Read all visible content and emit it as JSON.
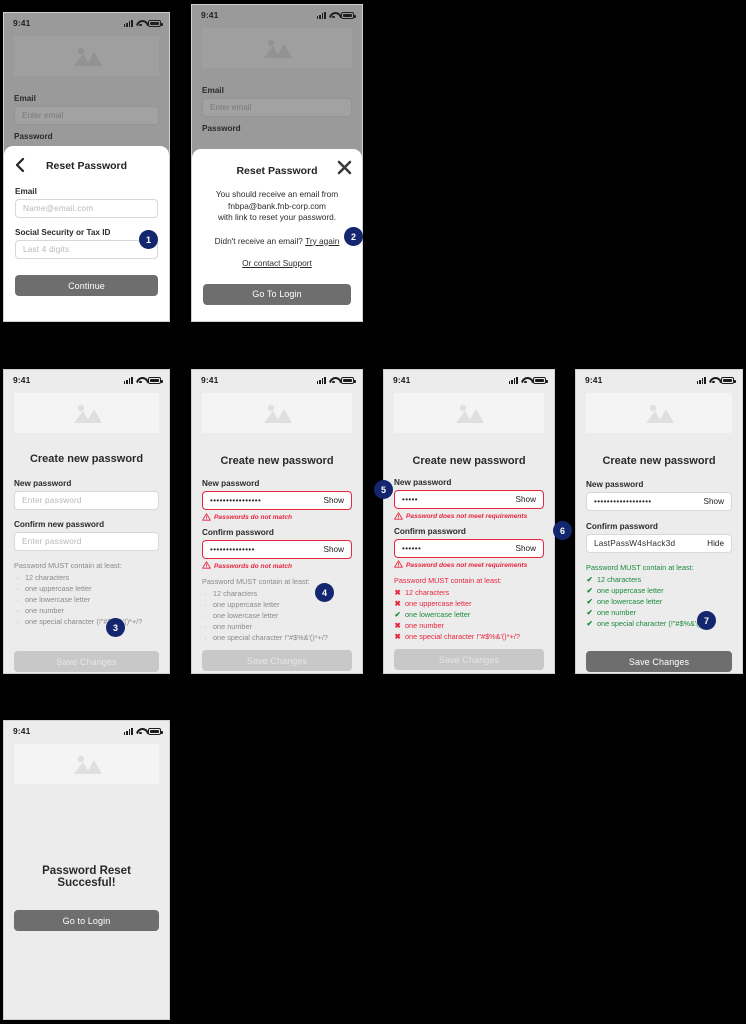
{
  "meta": {
    "status_time": "9:41",
    "accent_badge_color": "#13266e",
    "error_color": "#e8253f",
    "success_color": "#1a8a3c",
    "muted_color": "#8a8a8a",
    "button_color": "#6e6e6e"
  },
  "screens": {
    "reset_password_form": {
      "background": {
        "email_label": "Email",
        "email_placeholder": "Enter email",
        "password_label": "Password"
      },
      "modal": {
        "title": "Reset Password",
        "back_icon": "chevron-left-icon",
        "email_label": "Email",
        "email_placeholder": "Name@email.com",
        "ssn_label": "Social Security or Tax ID",
        "ssn_placeholder": "Last 4 digits",
        "submit_label": "Continue"
      },
      "badge": "1"
    },
    "reset_password_sent": {
      "background": {
        "email_label": "Email",
        "email_placeholder": "Enter email",
        "password_label": "Password"
      },
      "modal": {
        "title": "Reset Password",
        "close_icon": "close-icon",
        "body_line_1": "You should receive an email from",
        "body_line_2": "fnbpa@bank.fnb-corp.com",
        "body_line_3": "with link to reset your password.",
        "retry_prefix": "Didn't receive an email?",
        "retry_link": "Try again",
        "support_link": "Or contact Support",
        "submit_label": "Go To Login"
      },
      "badge": "2"
    },
    "create_password_empty": {
      "title": "Create new password",
      "new_password_label": "New password",
      "new_password_placeholder": "Enter password",
      "new_password_value": "",
      "confirm_label": "Confirm new password",
      "confirm_placeholder": "Enter password",
      "confirm_value": "",
      "requirements_heading": "Password MUST contain at least:",
      "requirements": [
        {
          "text": "12 characters",
          "state": "neutral"
        },
        {
          "text": "one uppercase letter",
          "state": "neutral"
        },
        {
          "text": "one lowercase letter",
          "state": "neutral"
        },
        {
          "text": "one number",
          "state": "neutral"
        },
        {
          "text": "one special character (!\"#$%&'()*+/?",
          "state": "neutral"
        }
      ],
      "save_label": "Save Changes",
      "save_enabled": false,
      "badge": "3"
    },
    "create_password_mismatch": {
      "title": "Create new password",
      "new_password_label": "New password",
      "new_password_value": "••••••••••••••••",
      "new_password_toggle": "Show",
      "new_password_error": "Passwords do not match",
      "confirm_label": "Confirm password",
      "confirm_value": "••••••••••••••",
      "confirm_toggle": "Show",
      "confirm_error": "Passwords do not match",
      "requirements_heading": "Password MUST contain at least:",
      "requirements": [
        {
          "text": "12 characters",
          "state": "neutral"
        },
        {
          "text": "one uppercase letter",
          "state": "neutral"
        },
        {
          "text": "one lowercase letter",
          "state": "neutral"
        },
        {
          "text": "one number",
          "state": "neutral"
        },
        {
          "text": "one special character !\"#$%&'()*+/?",
          "state": "neutral"
        }
      ],
      "save_label": "Save Changes",
      "save_enabled": false,
      "badge": "4"
    },
    "create_password_requirements": {
      "title": "Create new password",
      "new_password_label": "New password",
      "new_password_value": "•••••",
      "new_password_toggle": "Show",
      "new_password_error": "Password does not meet requirements",
      "confirm_label": "Confirm password",
      "confirm_value": "••••••",
      "confirm_toggle": "Show",
      "confirm_error": "Password does not meet requirements",
      "requirements_heading": "Password MUST contain at least:",
      "requirements": [
        {
          "text": "12 characters",
          "state": "bad"
        },
        {
          "text": "one uppercase letter",
          "state": "bad"
        },
        {
          "text": "one lowercase letter",
          "state": "good"
        },
        {
          "text": "one number",
          "state": "bad"
        },
        {
          "text": "one special character !\"#$%&'()*+/?",
          "state": "bad"
        }
      ],
      "save_label": "Save Changes",
      "save_enabled": false,
      "badge_left": "5",
      "badge_right": "6"
    },
    "create_password_valid": {
      "title": "Create new password",
      "new_password_label": "New password",
      "new_password_value": "••••••••••••••••••",
      "new_password_toggle": "Show",
      "confirm_label": "Confirm password",
      "confirm_value": "LastPassW4sHack3d",
      "confirm_toggle": "Hide",
      "requirements_heading": "Password MUST contain at least:",
      "requirements": [
        {
          "text": "12 characters",
          "state": "good"
        },
        {
          "text": "one uppercase letter",
          "state": "good"
        },
        {
          "text": "one lowercase letter",
          "state": "good"
        },
        {
          "text": "one number",
          "state": "good"
        },
        {
          "text": "one special character (!\"#$%&'()*+/?",
          "state": "good"
        }
      ],
      "save_label": "Save Changes",
      "save_enabled": true,
      "badge": "7"
    },
    "password_reset_success": {
      "title": "Password Reset Succesful!",
      "button_label": "Go to Login"
    }
  }
}
